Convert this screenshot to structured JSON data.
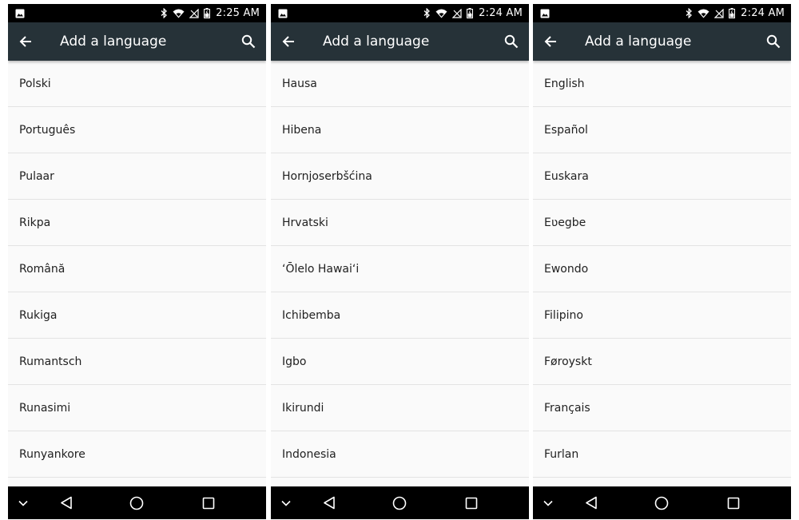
{
  "screens": [
    {
      "status_time": "2:25 AM",
      "title": "Add a language",
      "languages": [
        "Polski",
        "Português",
        "Pulaar",
        "Rikpa",
        "Română",
        "Rukiga",
        "Rumantsch",
        "Runasimi",
        "Runyankore"
      ]
    },
    {
      "status_time": "2:24 AM",
      "title": "Add a language",
      "languages": [
        "Hausa",
        "Hibena",
        "Hornjoserbšćina",
        "Hrvatski",
        "ʻŌlelo Hawaiʻi",
        "Ichibemba",
        "Igbo",
        "Ikirundi",
        "Indonesia"
      ]
    },
    {
      "status_time": "2:24 AM",
      "title": "Add a language",
      "languages": [
        "English",
        "Español",
        "Euskara",
        "Eʋegbe",
        "Ewondo",
        "Filipino",
        "Føroyskt",
        "Français",
        "Furlan"
      ]
    }
  ],
  "icons": {
    "notification": "image-notification-icon",
    "bluetooth": "bluetooth-icon",
    "wifi": "wifi-icon",
    "no_sim": "no-sim-icon",
    "battery": "battery-icon",
    "back": "arrow-back-icon",
    "search": "search-icon",
    "collapse": "chevron-down-icon",
    "nav_back": "triangle-back-icon",
    "home": "circle-home-icon",
    "recents": "square-recents-icon"
  },
  "colors": {
    "toolbar": "#263238",
    "status_bar": "#000000",
    "nav_bar": "#000000",
    "list_background": "#fafafa",
    "divider": "#e3e3e3",
    "text": "#212121"
  }
}
